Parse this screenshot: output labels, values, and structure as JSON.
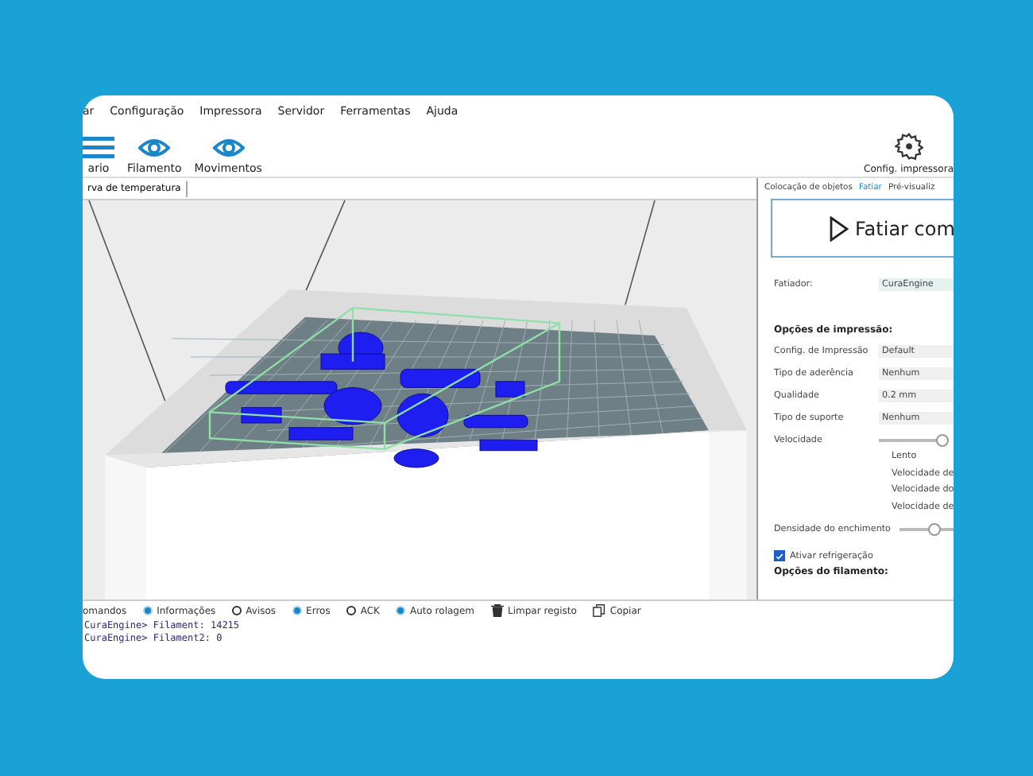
{
  "menu": [
    "ar",
    "Configuração",
    "Impressora",
    "Servidor",
    "Ferramentas",
    "Ajuda"
  ],
  "toolbar": [
    {
      "label": "ario",
      "kind": "menu"
    },
    {
      "label": "Filamento",
      "kind": "eye"
    },
    {
      "label": "Movimentos",
      "kind": "eye"
    }
  ],
  "printer_settings_button": "Config. impressora",
  "left_tab": "rva de temperatura",
  "right_tabs": [
    {
      "label": "Colocação de objetos",
      "selected": false
    },
    {
      "label": "Fatiar",
      "selected": true
    },
    {
      "label": "Pré-visualiz",
      "selected": false
    }
  ],
  "slice_button": "Fatiar com",
  "slicer": {
    "label": "Fatiador:",
    "value": "CuraEngine"
  },
  "print_options": {
    "title": "Opções de impressão:",
    "rows": [
      {
        "label": "Config. de Impressão",
        "value": "Default"
      },
      {
        "label": "Tipo de aderência",
        "value": "Nenhum"
      },
      {
        "label": "Qualidade",
        "value": "0.2 mm"
      },
      {
        "label": "Tipo de suporte",
        "value": "Nenhum"
      }
    ],
    "speed": {
      "label": "Velocidade",
      "level": 0.9
    },
    "speed_items": [
      "Lento",
      "Velocidade de",
      "Velocidade do",
      "Velocidade de"
    ],
    "infill": {
      "label": "Densidade do enchimento",
      "level": 0.65
    },
    "cooling": {
      "label": "Ativar refrigeração",
      "checked": true
    }
  },
  "filament_options_title": "Opções do filamento:",
  "log": {
    "commands": "omandos",
    "filters": [
      {
        "label": "Informações",
        "selected": true
      },
      {
        "label": "Avisos",
        "selected": false
      },
      {
        "label": "Erros",
        "selected": true
      },
      {
        "label": "ACK",
        "selected": false
      },
      {
        "label": "Auto rolagem",
        "selected": true
      }
    ],
    "clear": "Limpar registo",
    "copy": "Copiar",
    "lines": [
      "CuraEngine> Filament: 14215",
      "CuraEngine> Filament2: 0"
    ]
  }
}
